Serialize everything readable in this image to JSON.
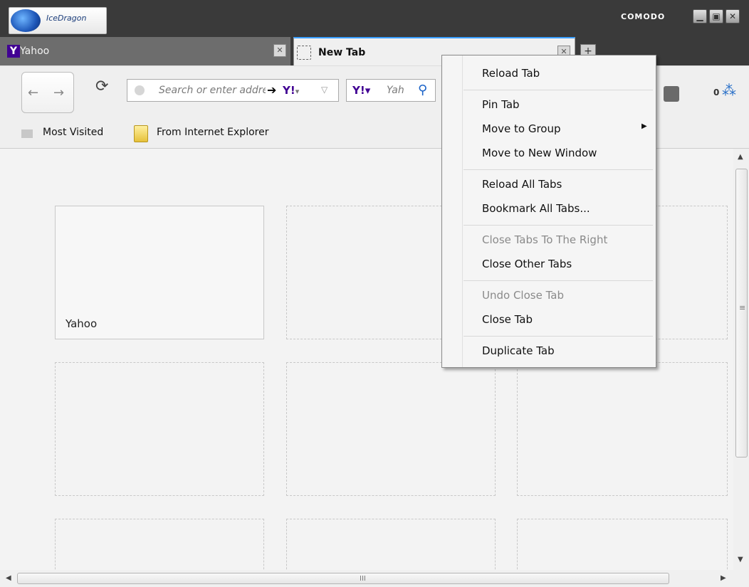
{
  "app": {
    "logo_text": "IceDragon",
    "brand": "COMODO"
  },
  "window_controls": {
    "minimize": "▁",
    "maximize": "▣",
    "close": "✕"
  },
  "tabs": [
    {
      "label": "Yahoo",
      "icon": "yahoo-y-icon",
      "close": "✕"
    },
    {
      "label": "New Tab",
      "icon": "dashed-page-icon",
      "close": "✕"
    }
  ],
  "new_tab_button": "+",
  "toolbar": {
    "back": "←",
    "forward": "→",
    "reload": "⟳",
    "url_placeholder": "Search or enter address",
    "go": "➔",
    "url_engine": "Y!",
    "url_dropdown": "▾",
    "url_history_caret": "▽",
    "search_engine": "Y!▾",
    "search_placeholder": "Yah",
    "search_icon": "⚲",
    "counter": "0",
    "share_icon": "⁂"
  },
  "bookmarks": [
    {
      "label": "Most Visited",
      "icon": "folder-icon"
    },
    {
      "label": "From Internet Explorer",
      "icon": "folder-icon"
    }
  ],
  "tiles": [
    {
      "title": "Yahoo",
      "filled": true
    },
    {
      "title": "",
      "filled": false
    },
    {
      "title": "",
      "filled": false
    },
    {
      "title": "",
      "filled": false
    },
    {
      "title": "",
      "filled": false
    },
    {
      "title": "",
      "filled": false
    },
    {
      "title": "",
      "filled": false
    },
    {
      "title": "",
      "filled": false
    },
    {
      "title": "",
      "filled": false
    }
  ],
  "scrollbars": {
    "up": "▲",
    "down": "▼",
    "left": "◀",
    "right": "▶",
    "grip_v": "≡",
    "grip_h": "III"
  },
  "context_menu": {
    "items": [
      {
        "label": "Reload Tab",
        "disabled": false
      },
      {
        "label": "Pin Tab",
        "disabled": false
      },
      {
        "label": "Move to Group",
        "disabled": false,
        "submenu": true
      },
      {
        "label": "Move to New Window",
        "disabled": false
      },
      {
        "label": "Reload All Tabs",
        "disabled": false
      },
      {
        "label": "Bookmark All Tabs...",
        "disabled": false
      },
      {
        "label": "Close Tabs To The Right",
        "disabled": true
      },
      {
        "label": "Close Other Tabs",
        "disabled": false
      },
      {
        "label": "Undo Close Tab",
        "disabled": true
      },
      {
        "label": "Close Tab",
        "disabled": false
      },
      {
        "label": "Duplicate Tab",
        "disabled": false
      }
    ],
    "submenu_arrow": "▶"
  }
}
